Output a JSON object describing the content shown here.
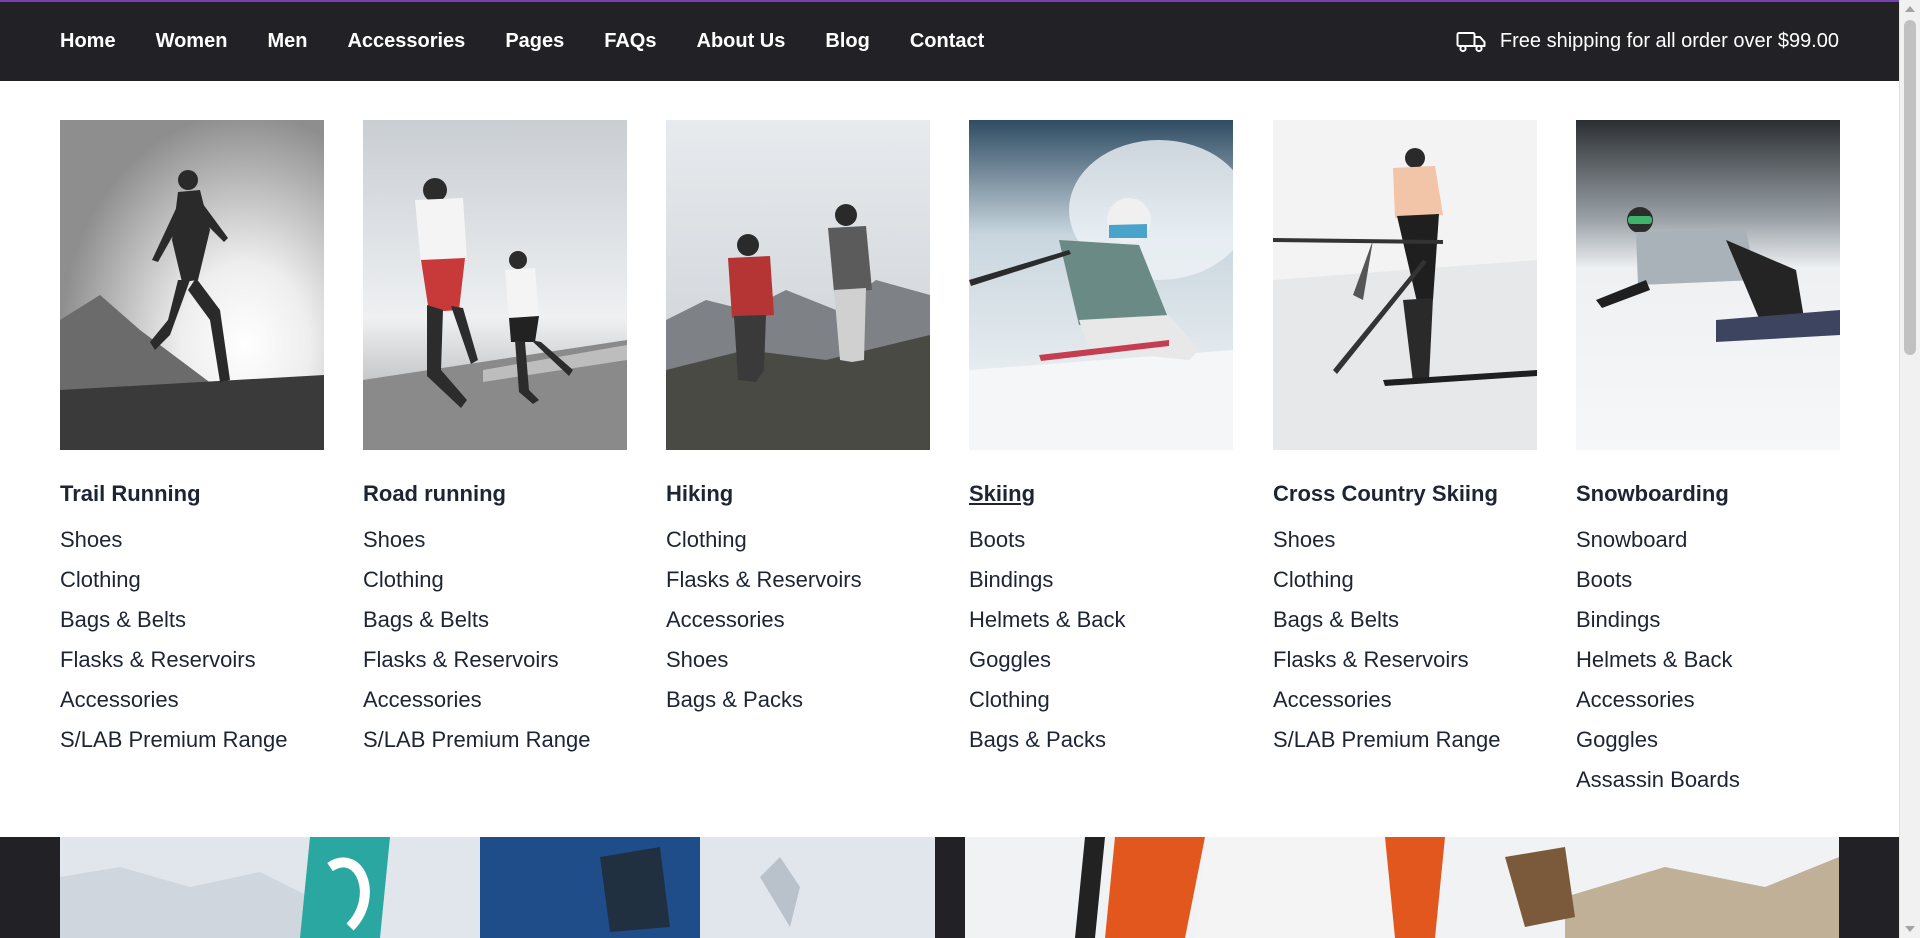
{
  "nav": {
    "links": [
      "Home",
      "Women",
      "Men",
      "Accessories",
      "Pages",
      "FAQs",
      "About Us",
      "Blog",
      "Contact"
    ],
    "shipping_text": "Free shipping for all order over $99.00",
    "shipping_icon": "truck-icon"
  },
  "menu": {
    "columns": [
      {
        "title": "Trail Running",
        "items": [
          "Shoes",
          "Clothing",
          "Bags & Belts",
          "Flasks & Reservoirs",
          "Accessories",
          "S/LAB Premium Range"
        ]
      },
      {
        "title": "Road running",
        "items": [
          "Shoes",
          "Clothing",
          "Bags & Belts",
          "Flasks & Reservoirs",
          "Accessories",
          "S/LAB Premium Range"
        ]
      },
      {
        "title": "Hiking",
        "items": [
          "Clothing",
          "Flasks & Reservoirs",
          "Accessories",
          "Shoes",
          "Bags & Packs"
        ]
      },
      {
        "title": "Skiing",
        "items": [
          "Boots",
          "Bindings",
          "Helmets & Back",
          "Goggles",
          "Clothing",
          "Bags & Packs"
        ]
      },
      {
        "title": "Cross Country Skiing",
        "items": [
          "Shoes",
          "Clothing",
          "Bags & Belts",
          "Flasks & Reservoirs",
          "Accessories",
          "S/LAB Premium Range"
        ]
      },
      {
        "title": "Snowboarding",
        "items": [
          "Snowboard",
          "Boots",
          "Bindings",
          "Helmets & Back",
          "Accessories",
          "Goggles",
          "Assassin Boards"
        ]
      }
    ]
  },
  "colors": {
    "nav_bg": "#222226",
    "accent_line": "#7a3fb5",
    "menu_text": "#1d2433"
  }
}
